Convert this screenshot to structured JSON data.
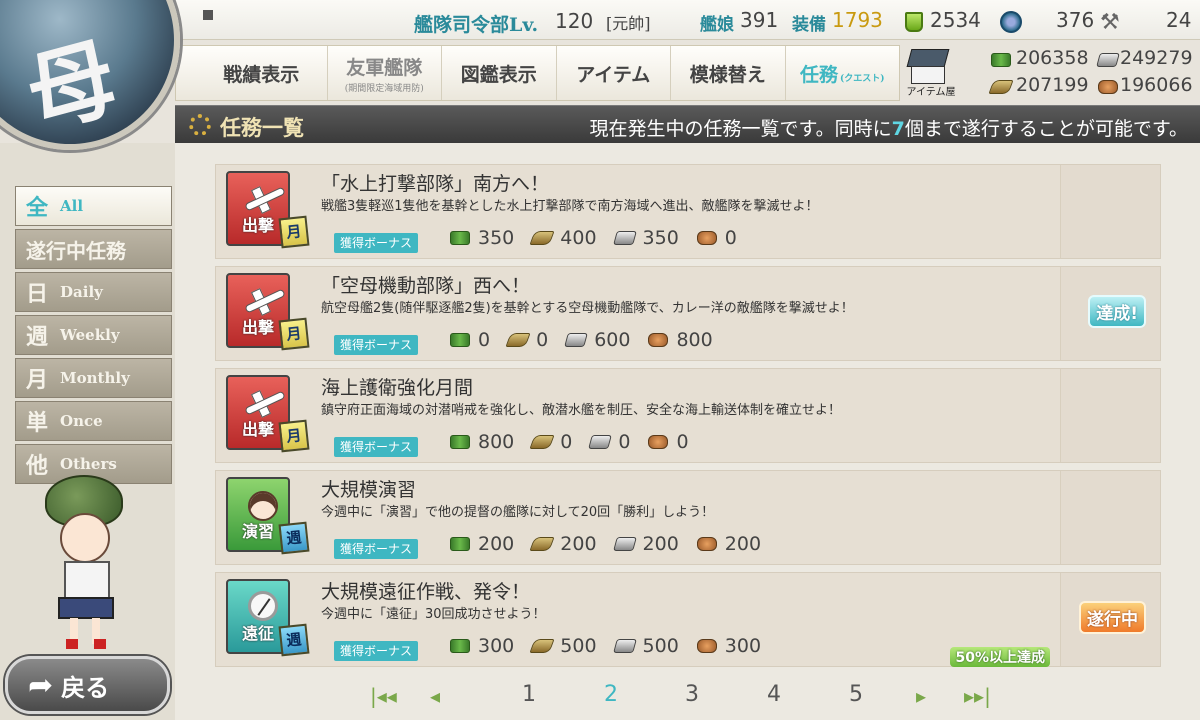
{
  "topbar": {
    "hq_label": "艦隊司令部Lv.",
    "hq_level": "120",
    "hq_rank": "[元帥]",
    "ships_label": "艦娘",
    "ships_count": "391",
    "equip_label": "装備",
    "equip_count": "1793",
    "bucket_count": "2534",
    "screw_count": "376",
    "dev_count": "24"
  },
  "nav": {
    "items": [
      {
        "label": "戦績表示",
        "sub": ""
      },
      {
        "label": "友軍艦隊",
        "sub": "(期間限定海域用防)"
      },
      {
        "label": "図鑑表示",
        "sub": ""
      },
      {
        "label": "アイテム",
        "sub": ""
      },
      {
        "label": "模様替え",
        "sub": ""
      },
      {
        "label": "任務",
        "sub": "(クエスト)"
      }
    ],
    "shop_label": "アイテム屋"
  },
  "resources": {
    "fuel": "206358",
    "steel": "249279",
    "ammo": "207199",
    "bauxite": "196066"
  },
  "title": {
    "text": "任務一覧",
    "info_pre": "現在発生中の任務一覧です。同時に",
    "info_num": "7",
    "info_post": "個まで遂行することが可能です。"
  },
  "emblem": {
    "glyph": "母"
  },
  "sidebar": {
    "tabs": [
      {
        "big": "全",
        "small": "All"
      },
      {
        "big": "遂行中任務",
        "small": ""
      },
      {
        "big": "日",
        "small": "Daily"
      },
      {
        "big": "週",
        "small": "Weekly"
      },
      {
        "big": "月",
        "small": "Monthly"
      },
      {
        "big": "単",
        "small": "Once"
      },
      {
        "big": "他",
        "small": "Others"
      }
    ]
  },
  "back": {
    "label": "戻る"
  },
  "bonus_label": "獲得ボーナス",
  "quests": [
    {
      "type": "出撃",
      "freq": "月",
      "title": "「水上打撃部隊」南方へ！",
      "desc": "戦艦3隻軽巡1隻他を基幹とした水上打撃部隊で南方海域へ進出、敵艦隊を撃滅せよ！",
      "fuel": "350",
      "ammo": "400",
      "steel": "350",
      "bauxite": "0",
      "badge": "",
      "progress": ""
    },
    {
      "type": "出撃",
      "freq": "月",
      "title": "「空母機動部隊」西へ！",
      "desc": "航空母艦2隻(随伴駆逐艦2隻)を基幹とする空母機動艦隊で、カレー洋の敵艦隊を撃滅せよ！",
      "fuel": "0",
      "ammo": "0",
      "steel": "600",
      "bauxite": "800",
      "badge": "達成!",
      "progress": ""
    },
    {
      "type": "出撃",
      "freq": "月",
      "title": "海上護衛強化月間",
      "desc": "鎮守府正面海域の対潜哨戒を強化し、敵潜水艦を制圧、安全な海上輸送体制を確立せよ！",
      "fuel": "800",
      "ammo": "0",
      "steel": "0",
      "bauxite": "0",
      "badge": "",
      "progress": ""
    },
    {
      "type": "演習",
      "freq": "週",
      "title": "大規模演習",
      "desc": "今週中に「演習」で他の提督の艦隊に対して20回「勝利」しよう！",
      "fuel": "200",
      "ammo": "200",
      "steel": "200",
      "bauxite": "200",
      "badge": "",
      "progress": ""
    },
    {
      "type": "遠征",
      "freq": "週",
      "title": "大規模遠征作戦、発令！",
      "desc": "今週中に「遠征」30回成功させよう！",
      "fuel": "300",
      "ammo": "500",
      "steel": "500",
      "bauxite": "300",
      "badge": "遂行中",
      "progress": "50%以上達成"
    }
  ],
  "pager": {
    "first": "|◂◂",
    "prev": "◂",
    "pages": [
      "1",
      "2",
      "3",
      "4",
      "5"
    ],
    "current": "2",
    "next": "▸",
    "last": "▸▸|"
  },
  "colors": {
    "accent": "#3fb7c2",
    "sortie": "#d8453f",
    "exercise": "#5ab84a",
    "expedition": "#3ab8b0",
    "done_badge": "#3fb7c2",
    "inprogress_badge": "#ef7a2a"
  }
}
